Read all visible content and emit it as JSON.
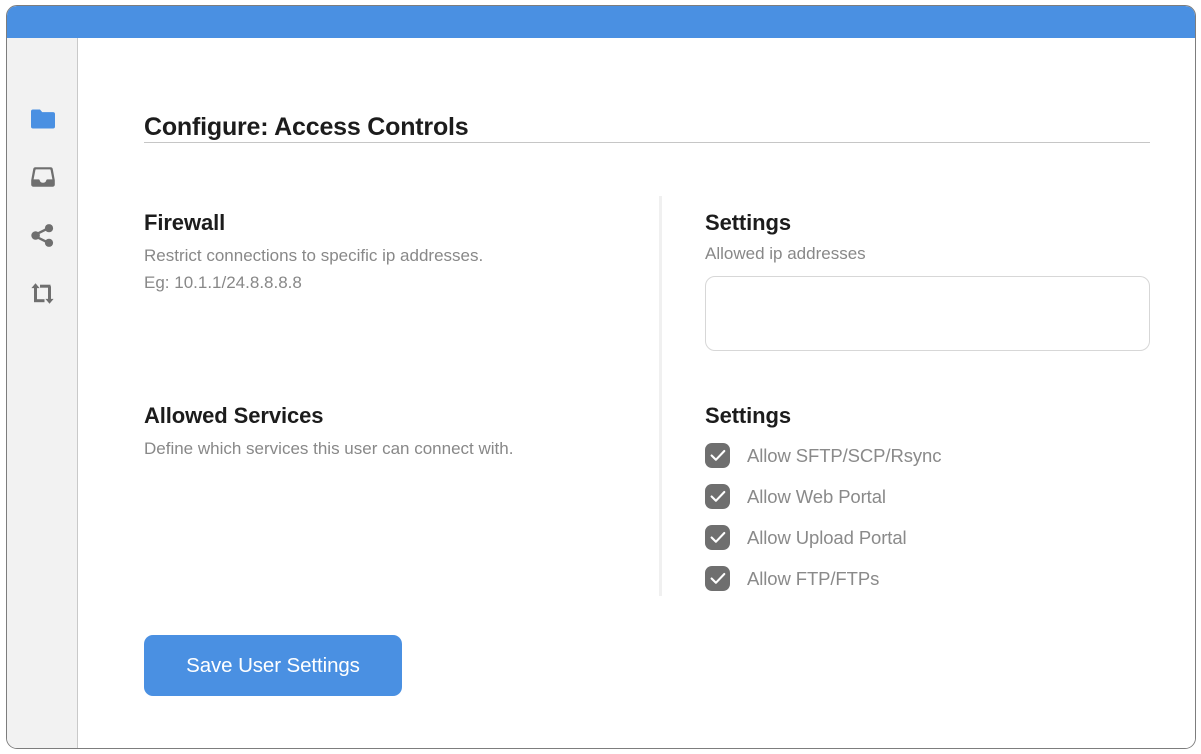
{
  "window": {
    "titlebar_color": "#4a90e2",
    "border_color": "#7d7d7d"
  },
  "sidebar": {
    "background_color": "#f2f2f2",
    "active_color": "#4a90e2",
    "inactive_color": "#6f6f6f",
    "items": [
      {
        "icon": "folder-icon",
        "active": true
      },
      {
        "icon": "inbox-icon",
        "active": false
      },
      {
        "icon": "share-icon",
        "active": false
      },
      {
        "icon": "exchange-icon",
        "active": false
      }
    ]
  },
  "page": {
    "title": "Configure: Access Controls"
  },
  "firewall": {
    "heading": "Firewall",
    "description_line1": "Restrict connections to specific ip addresses.",
    "description_line2": "Eg: 10.1.1/24.8.8.8.8",
    "settings_heading": "Settings",
    "settings_label": "Allowed ip addresses",
    "ip_value": "",
    "ip_placeholder": ""
  },
  "allowed_services": {
    "heading": "Allowed Services",
    "description": "Define which services this user can connect with.",
    "settings_heading": "Settings",
    "checkbox_color": "#6f6f6f",
    "options": [
      {
        "label": "Allow SFTP/SCP/Rsync",
        "checked": true
      },
      {
        "label": "Allow Web Portal",
        "checked": true
      },
      {
        "label": "Allow Upload Portal",
        "checked": true
      },
      {
        "label": "Allow FTP/FTPs",
        "checked": true
      }
    ]
  },
  "actions": {
    "save_label": "Save User Settings",
    "save_color": "#4a90e2"
  }
}
